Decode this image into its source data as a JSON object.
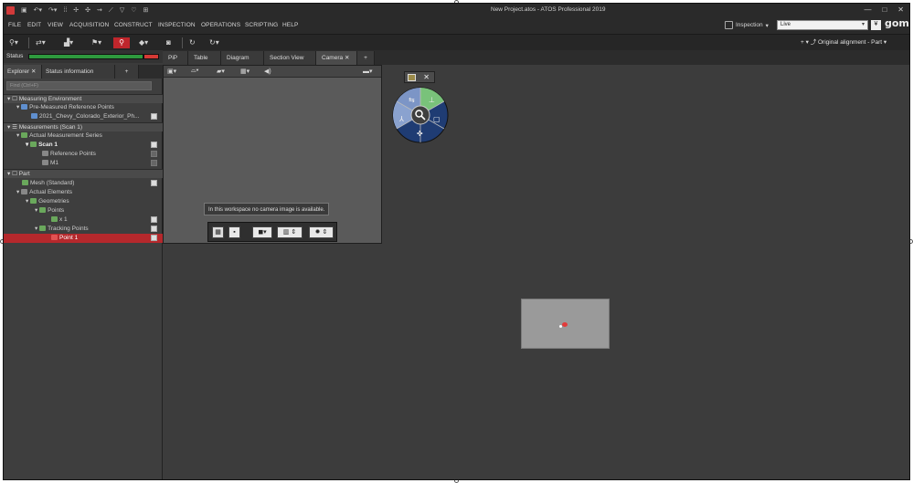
{
  "window": {
    "title": "New Project.atos - ATOS Professional 2019",
    "controls": [
      "—",
      "□",
      "✕"
    ]
  },
  "menu": [
    "FILE",
    "EDIT",
    "VIEW",
    "ACQUISITION",
    "CONSTRUCT",
    "INSPECTION",
    "OPERATIONS",
    "SCRIPTING",
    "HELP"
  ],
  "topright": {
    "workspace_label": "Inspection",
    "live_value": "Live",
    "live_button": "¥",
    "brand": "gom",
    "alignment": "Original alignment - Part"
  },
  "status": {
    "label": "Status",
    "progress_green": 0.88,
    "progress_red": 0.12
  },
  "left_tabs": [
    "Explorer",
    "Status information",
    "+"
  ],
  "search_placeholder": "Find (Ctrl+F)",
  "explorer": {
    "measuring_environment": "Measuring Environment",
    "pre_measured": "Pre-Measured Reference Points",
    "pre_measured_file": "2021_Chevy_Colorado_Exterior_Ph...",
    "measurements": "Measurements (Scan 1)",
    "actual_series": "Actual Measurement Series",
    "scan1": "Scan 1",
    "reference_points": "Reference Points",
    "m1": "M1",
    "part": "Part",
    "mesh": "Mesh (Standard)",
    "actual_elements": "Actual Elements",
    "geometries": "Geometries",
    "points": "Points",
    "x1": "x 1",
    "tracking_points": "Tracking Points",
    "point1": "Point 1"
  },
  "view_tabs": [
    "PiP",
    "Table",
    "Diagram",
    "Section View",
    "Camera",
    "+"
  ],
  "camera": {
    "close": "✕",
    "message": "In this workspace no camera image is available."
  },
  "icons": {
    "nav_wheel": "navigation-wheel-icon",
    "search": "magnifier-icon",
    "camera": "camera-icon"
  },
  "colors": {
    "accent_red": "#c0262c",
    "status_green": "#2e9a3e"
  }
}
